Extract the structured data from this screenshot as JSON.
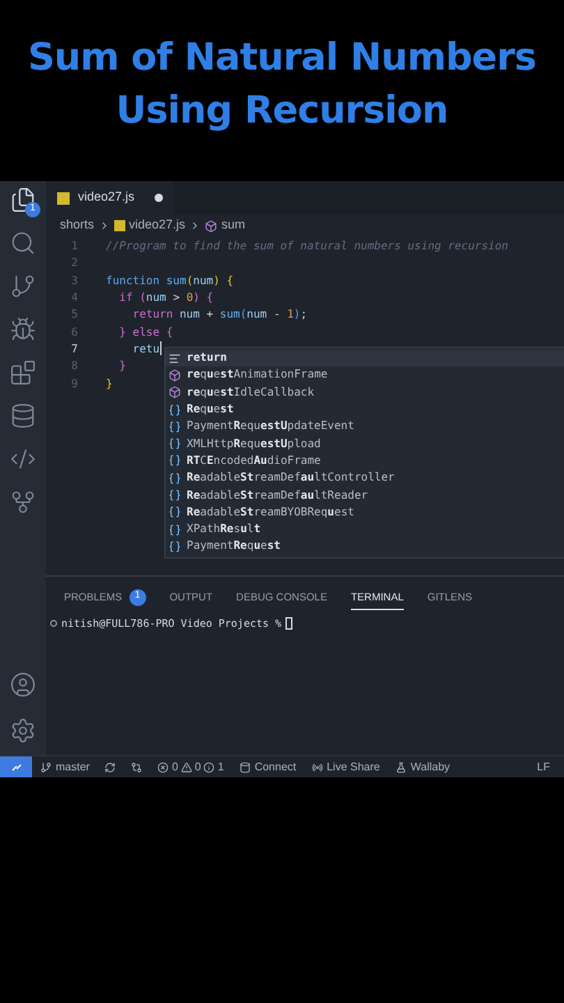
{
  "heading": [
    "Sum of Natural Numbers",
    "Using Recursion"
  ],
  "activity_bar": {
    "items": [
      {
        "kind": "files",
        "selected": true,
        "badge": "1"
      },
      {
        "kind": "search",
        "selected": false
      },
      {
        "kind": "branch",
        "selected": false
      },
      {
        "kind": "debug",
        "selected": false
      },
      {
        "kind": "extensions",
        "selected": false
      },
      {
        "kind": "database",
        "selected": false
      },
      {
        "kind": "python",
        "selected": false
      },
      {
        "kind": "git",
        "selected": false
      }
    ],
    "bottom": [
      {
        "kind": "account"
      },
      {
        "kind": "settings"
      }
    ]
  },
  "tab": {
    "label": "video27.js",
    "modified": true
  },
  "breadcrumb": [
    "shorts",
    "video27.js",
    "sum"
  ],
  "code": [
    {
      "number": "1",
      "current": false,
      "tokens": [
        {
          "kind": "comment",
          "text": "//Program to find the sum of natural numbers using recursion"
        }
      ]
    },
    {
      "number": "2",
      "current": false
    },
    {
      "number": "3",
      "current": false,
      "tokens": [
        {
          "kind": "keyword",
          "text": "function "
        },
        {
          "kind": "function",
          "text": "sum"
        },
        {
          "kind": "bracket",
          "text": "("
        },
        {
          "kind": "variable",
          "text": "num"
        },
        {
          "kind": "bracket",
          "text": ") "
        },
        {
          "kind": "bracket",
          "text": "{"
        }
      ]
    },
    {
      "number": "4",
      "current": false,
      "tokens": [
        {
          "kind": "control",
          "text": "  if "
        },
        {
          "kind": "bracket2",
          "text": "("
        },
        {
          "kind": "variable",
          "text": "num"
        },
        {
          "kind": "plain",
          "text": " > "
        },
        {
          "kind": "number",
          "text": "0"
        },
        {
          "kind": "bracket2",
          "text": ") "
        },
        {
          "kind": "bracket2",
          "text": "{"
        }
      ]
    },
    {
      "number": "5",
      "current": false,
      "tokens": [
        {
          "kind": "control",
          "text": "    return "
        },
        {
          "kind": "variable",
          "text": "num"
        },
        {
          "kind": "plain",
          "text": " + "
        },
        {
          "kind": "function",
          "text": "sum"
        },
        {
          "kind": "bracket3",
          "text": "("
        },
        {
          "kind": "variable",
          "text": "num"
        },
        {
          "kind": "plain",
          "text": " - "
        },
        {
          "kind": "number",
          "text": "1"
        },
        {
          "kind": "bracket3",
          "text": ")"
        },
        {
          "kind": "plain",
          "text": ";"
        }
      ]
    },
    {
      "number": "6",
      "current": false,
      "tokens": [
        {
          "kind": "bracket2",
          "text": "  }"
        },
        {
          "kind": "control",
          "text": " else "
        },
        {
          "kind": "bracket2",
          "text": "{"
        }
      ]
    },
    {
      "number": "7",
      "current": true,
      "tokens": [
        {
          "kind": "variable",
          "text": "    retu"
        }
      ]
    },
    {
      "number": "8",
      "current": false,
      "tokens": [
        {
          "kind": "bracket2",
          "text": "  }"
        }
      ]
    },
    {
      "number": "9",
      "current": false,
      "tokens": [
        {
          "kind": "bracket",
          "text": "}"
        }
      ]
    }
  ],
  "suggestions": [
    {
      "kind": "keyword",
      "label": "**return**",
      "selected": true
    },
    {
      "kind": "method",
      "label": "**re**q**u**e**st**AnimationFrame",
      "selected": false
    },
    {
      "kind": "method",
      "label": "**re**q**u**e**st**IdleCallback",
      "selected": false
    },
    {
      "kind": "variable",
      "label": "**Re**q**u**e**st**",
      "selected": false
    },
    {
      "kind": "variable",
      "label": "Payment**R**equ**estU**pdateEvent",
      "selected": false
    },
    {
      "kind": "variable",
      "label": "XMLHttp**R**equ**estU**pload",
      "selected": false
    },
    {
      "kind": "variable",
      "label": "**RT**C**E**ncoded**Au**dioFrame",
      "selected": false
    },
    {
      "kind": "variable",
      "label": "**Re**adable**St**reamDef**au**ltController",
      "selected": false
    },
    {
      "kind": "variable",
      "label": "**Re**adable**St**reamDef**au**ltReader",
      "selected": false
    },
    {
      "kind": "variable",
      "label": "**Re**adable**St**reamBYOBReq**u**est",
      "selected": false
    },
    {
      "kind": "variable",
      "label": "XPath**Re**s**u**l**t**",
      "selected": false
    },
    {
      "kind": "variable",
      "label": "Payment**Re**q**u**e**st**",
      "selected": false
    }
  ],
  "panel": {
    "tabs": [
      {
        "label": "PROBLEMS",
        "badge": "1",
        "selected": false
      },
      {
        "label": "OUTPUT",
        "selected": false
      },
      {
        "label": "DEBUG CONSOLE",
        "selected": false
      },
      {
        "label": "TERMINAL",
        "selected": true
      },
      {
        "label": "GITLENS",
        "selected": false
      }
    ],
    "prompt": "nitish@FULL786-PRO Video Projects %"
  },
  "status_bar": [
    {
      "kind": "branch",
      "text": "master"
    },
    {
      "kind": "sync"
    },
    {
      "kind": "compare"
    },
    {
      "kind": "problems",
      "errors": "0",
      "warnings": "0",
      "infos": "1"
    },
    {
      "kind": "database",
      "text": "Connect"
    },
    {
      "kind": "share",
      "text": "Live Share"
    },
    {
      "kind": "flask",
      "text": "Wallaby"
    },
    {
      "kind": "plain",
      "text": "LF"
    }
  ]
}
